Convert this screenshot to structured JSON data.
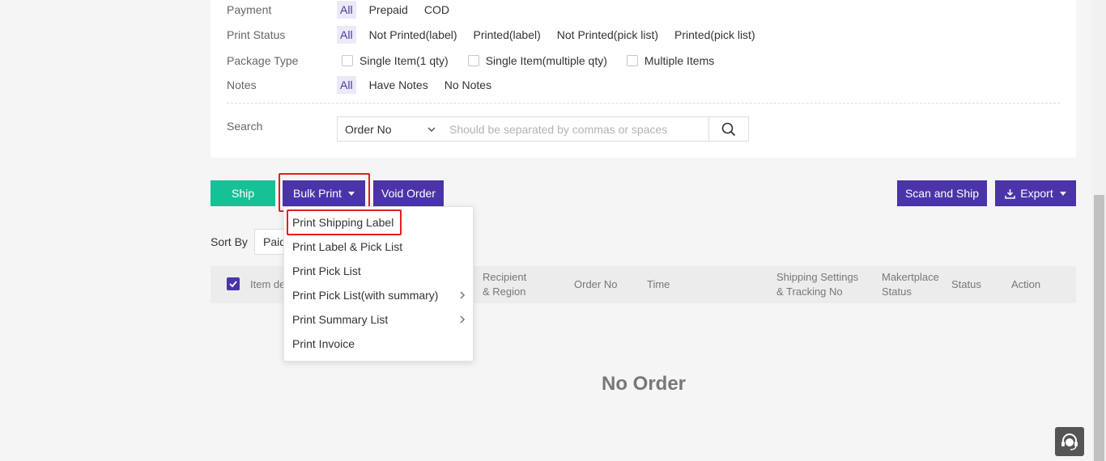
{
  "filters": {
    "payment": {
      "label": "Payment",
      "options": [
        "All",
        "Prepaid",
        "COD"
      ]
    },
    "print_status": {
      "label": "Print Status",
      "options": [
        "All",
        "Not Printed(label)",
        "Printed(label)",
        "Not Printed(pick list)",
        "Printed(pick list)"
      ]
    },
    "package_type": {
      "label": "Package Type",
      "options": [
        "Single Item(1 qty)",
        "Single Item(multiple qty)",
        "Multiple Items"
      ]
    },
    "notes": {
      "label": "Notes",
      "options": [
        "All",
        "Have Notes",
        "No Notes"
      ]
    },
    "search": {
      "label": "Search",
      "field": "Order No",
      "placeholder": "Should be separated by commas or spaces"
    }
  },
  "toolbar": {
    "ship": "Ship",
    "bulk_print": "Bulk Print",
    "void_order": "Void Order",
    "scan_and_ship": "Scan and Ship",
    "export": "Export"
  },
  "bulk_print_menu": [
    "Print Shipping Label",
    "Print Label & Pick List",
    "Print Pick List",
    "Print Pick List(with summary)",
    "Print Summary List",
    "Print Invoice"
  ],
  "sort": {
    "label": "Sort By",
    "value": "Paid"
  },
  "table": {
    "headers": {
      "item": "Item de",
      "recipient_1": "Recipient",
      "recipient_2": "& Region",
      "order_no": "Order No",
      "time": "Time",
      "shipping_1": "Shipping Settings",
      "shipping_2": "& Tracking No",
      "marketplace_1": "Makertplace",
      "marketplace_2": "Status",
      "status": "Status",
      "action": "Action"
    },
    "empty_text": "No Order"
  },
  "colors": {
    "primary": "#4b34a8",
    "ship": "#16c196",
    "highlight": "#e02020"
  },
  "icons": {
    "search": "search-icon",
    "export": "download-icon",
    "help": "headset-icon"
  }
}
